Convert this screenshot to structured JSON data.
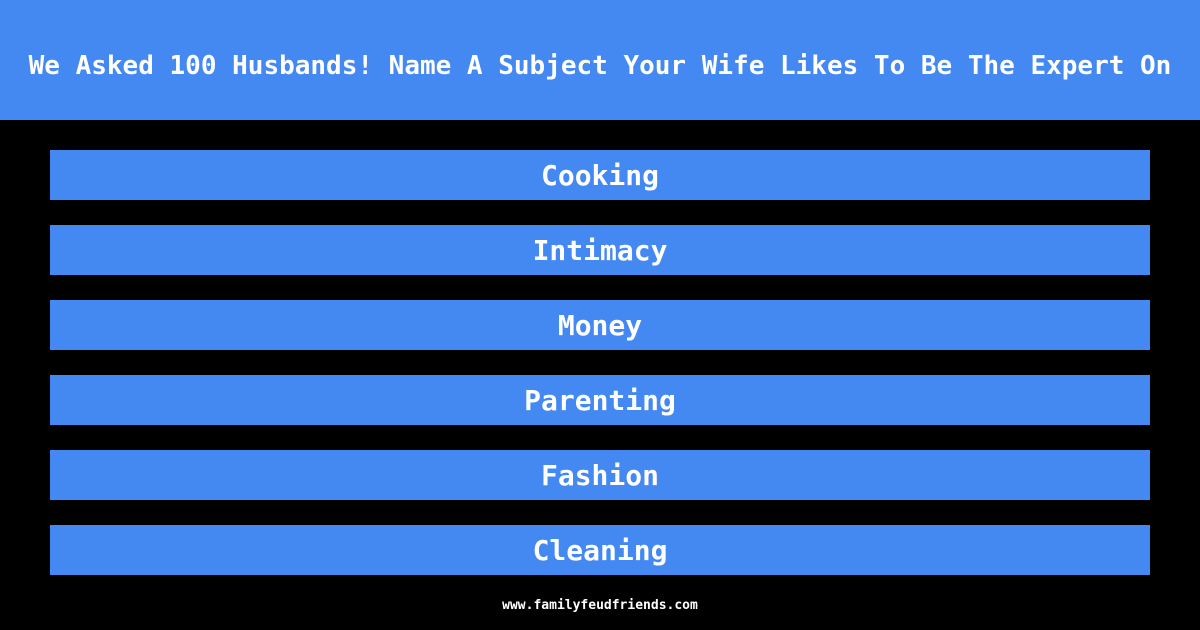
{
  "header": {
    "title": "We Asked 100 Husbands! Name A Subject Your Wife Likes To Be The Expert On"
  },
  "answers": [
    "Cooking",
    "Intimacy",
    "Money",
    "Parenting",
    "Fashion",
    "Cleaning"
  ],
  "footer": {
    "url": "www.familyfeudfriends.com"
  },
  "colors": {
    "accent": "#4488f2",
    "background": "#000000",
    "text": "#ffffff"
  }
}
